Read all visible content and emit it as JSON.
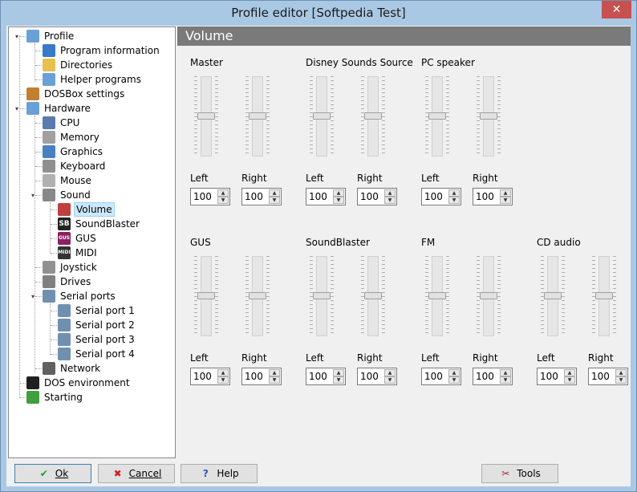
{
  "window": {
    "title": "Profile editor [Softpedia Test]",
    "close_glyph": "✕"
  },
  "tree": {
    "items": [
      {
        "label": "Profile",
        "icon": "profile-icon",
        "color": "#6aa0d8"
      },
      {
        "label": "Program information",
        "icon": "info-icon",
        "color": "#3a78c8"
      },
      {
        "label": "Directories",
        "icon": "folder-icon",
        "color": "#e8c050"
      },
      {
        "label": "Helper programs",
        "icon": "helper-icon",
        "color": "#6aa0d8"
      },
      {
        "label": "DOSBox settings",
        "icon": "dosbox-icon",
        "color": "#c08030"
      },
      {
        "label": "Hardware",
        "icon": "hardware-icon",
        "color": "#6aa0d8"
      },
      {
        "label": "CPU",
        "icon": "cpu-icon",
        "color": "#5a7ab0"
      },
      {
        "label": "Memory",
        "icon": "memory-icon",
        "color": "#a0a0a0"
      },
      {
        "label": "Graphics",
        "icon": "graphics-icon",
        "color": "#4a80c0"
      },
      {
        "label": "Keyboard",
        "icon": "keyboard-icon",
        "color": "#909090"
      },
      {
        "label": "Mouse",
        "icon": "mouse-icon",
        "color": "#b0b0b0"
      },
      {
        "label": "Sound",
        "icon": "speaker-icon",
        "color": "#888888"
      },
      {
        "label": "Volume",
        "icon": "volume-icon",
        "color": "#c04040"
      },
      {
        "label": "SoundBlaster",
        "icon": "soundblaster-icon",
        "color": "#222222",
        "glyph": "SB"
      },
      {
        "label": "GUS",
        "icon": "gus-icon",
        "color": "#8a2060",
        "glyph": "GUS"
      },
      {
        "label": "MIDI",
        "icon": "midi-icon",
        "color": "#333333",
        "glyph": "MIDI"
      },
      {
        "label": "Joystick",
        "icon": "joystick-icon",
        "color": "#909090"
      },
      {
        "label": "Drives",
        "icon": "drives-icon",
        "color": "#808080"
      },
      {
        "label": "Serial ports",
        "icon": "serial-ports-icon",
        "color": "#7090b0"
      },
      {
        "label": "Serial port 1",
        "icon": "serial-port-icon",
        "color": "#7090b0"
      },
      {
        "label": "Serial port 2",
        "icon": "serial-port-icon",
        "color": "#7090b0"
      },
      {
        "label": "Serial port 3",
        "icon": "serial-port-icon",
        "color": "#7090b0"
      },
      {
        "label": "Serial port 4",
        "icon": "serial-port-icon",
        "color": "#7090b0"
      },
      {
        "label": "Network",
        "icon": "network-icon",
        "color": "#606060"
      },
      {
        "label": "DOS environment",
        "icon": "dos-environment-icon",
        "color": "#202020"
      },
      {
        "label": "Starting",
        "icon": "starting-icon",
        "color": "#40a040"
      }
    ]
  },
  "panel": {
    "header": "Volume",
    "groups": [
      {
        "name": "Master",
        "left_label": "Left",
        "right_label": "Right",
        "left": "100",
        "right": "100"
      },
      {
        "name": "Disney Sounds Source",
        "left_label": "Left",
        "right_label": "Right",
        "left": "100",
        "right": "100"
      },
      {
        "name": "PC speaker",
        "left_label": "Left",
        "right_label": "Right",
        "left": "100",
        "right": "100"
      },
      {
        "name": "GUS",
        "left_label": "Left",
        "right_label": "Right",
        "left": "100",
        "right": "100"
      },
      {
        "name": "SoundBlaster",
        "left_label": "Left",
        "right_label": "Right",
        "left": "100",
        "right": "100"
      },
      {
        "name": "FM",
        "left_label": "Left",
        "right_label": "Right",
        "left": "100",
        "right": "100"
      },
      {
        "name": "CD audio",
        "left_label": "Left",
        "right_label": "Right",
        "left": "100",
        "right": "100"
      }
    ]
  },
  "buttons": {
    "ok": "Ok",
    "cancel": "Cancel",
    "help": "Help",
    "tools": "Tools",
    "ok_icon": "✔",
    "cancel_icon": "✖",
    "help_icon": "?",
    "tools_icon": "✂"
  }
}
